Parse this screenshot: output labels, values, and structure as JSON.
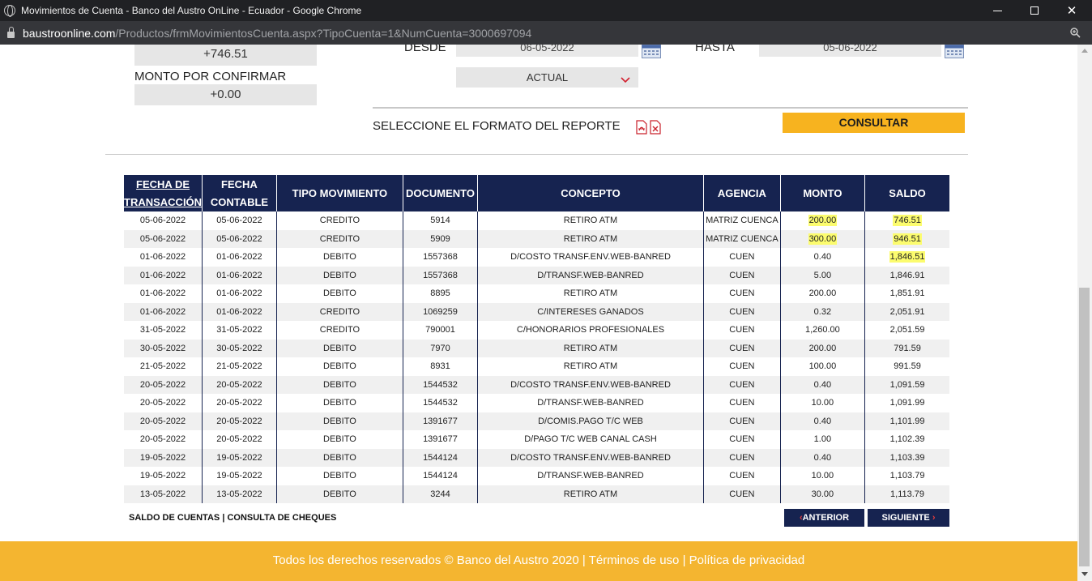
{
  "browser": {
    "window_title": "Movimientos de Cuenta - Banco del Austro OnLine - Ecuador - Google Chrome",
    "url_host": "baustroonline.com",
    "url_path": "/Productos/frmMovimientosCuenta.aspx?TipoCuenta=1&NumCuenta=3000697094"
  },
  "summary": {
    "saldo_value": "+746.51",
    "monto_por_confirmar_label": "MONTO POR CONFIRMAR",
    "monto_por_confirmar_value": "+0.00"
  },
  "filters": {
    "desde_label": "DESDE",
    "desde_value": "06-05-2022",
    "hasta_label": "HASTA",
    "hasta_value": "05-06-2022",
    "period_selected": "ACTUAL",
    "report_format_label": "SELECCIONE EL FORMATO DEL REPORTE",
    "consultar_label": "CONSULTAR"
  },
  "table": {
    "headers": {
      "fecha_transaccion": [
        "FECHA DE",
        "TRANSACCIÓN"
      ],
      "fecha_contable": [
        "FECHA",
        "CONTABLE"
      ],
      "tipo": "TIPO MOVIMIENTO",
      "documento": "DOCUMENTO",
      "concepto": "CONCEPTO",
      "agencia": "AGENCIA",
      "monto": "MONTO",
      "saldo": "SALDO"
    },
    "rows": [
      {
        "ft": "05-06-2022",
        "fc": "05-06-2022",
        "tipo": "CREDITO",
        "doc": "5914",
        "concepto": "RETIRO ATM",
        "agencia": "MATRIZ CUENCA",
        "monto": "200.00",
        "saldo": "746.51",
        "hl_monto": true,
        "hl_saldo": true
      },
      {
        "ft": "05-06-2022",
        "fc": "05-06-2022",
        "tipo": "CREDITO",
        "doc": "5909",
        "concepto": "RETIRO ATM",
        "agencia": "MATRIZ CUENCA",
        "monto": "300.00",
        "saldo": "946.51",
        "hl_monto": true,
        "hl_saldo": true
      },
      {
        "ft": "01-06-2022",
        "fc": "01-06-2022",
        "tipo": "DEBITO",
        "doc": "1557368",
        "concepto": "D/COSTO TRANSF.ENV.WEB-BANRED",
        "agencia": "CUEN",
        "monto": "0.40",
        "saldo": "1,846.51",
        "hl_monto": false,
        "hl_saldo": true
      },
      {
        "ft": "01-06-2022",
        "fc": "01-06-2022",
        "tipo": "DEBITO",
        "doc": "1557368",
        "concepto": "D/TRANSF.WEB-BANRED",
        "agencia": "CUEN",
        "monto": "5.00",
        "saldo": "1,846.91",
        "hl_monto": false,
        "hl_saldo": false
      },
      {
        "ft": "01-06-2022",
        "fc": "01-06-2022",
        "tipo": "DEBITO",
        "doc": "8895",
        "concepto": "RETIRO ATM",
        "agencia": "CUEN",
        "monto": "200.00",
        "saldo": "1,851.91",
        "hl_monto": false,
        "hl_saldo": false
      },
      {
        "ft": "01-06-2022",
        "fc": "01-06-2022",
        "tipo": "CREDITO",
        "doc": "1069259",
        "concepto": "C/INTERESES GANADOS",
        "agencia": "CUEN",
        "monto": "0.32",
        "saldo": "2,051.91",
        "hl_monto": false,
        "hl_saldo": false
      },
      {
        "ft": "31-05-2022",
        "fc": "31-05-2022",
        "tipo": "CREDITO",
        "doc": "790001",
        "concepto": "C/HONORARIOS PROFESIONALES",
        "agencia": "CUEN",
        "monto": "1,260.00",
        "saldo": "2,051.59",
        "hl_monto": false,
        "hl_saldo": false
      },
      {
        "ft": "30-05-2022",
        "fc": "30-05-2022",
        "tipo": "DEBITO",
        "doc": "7970",
        "concepto": "RETIRO ATM",
        "agencia": "CUEN",
        "monto": "200.00",
        "saldo": "791.59",
        "hl_monto": false,
        "hl_saldo": false
      },
      {
        "ft": "21-05-2022",
        "fc": "21-05-2022",
        "tipo": "DEBITO",
        "doc": "8931",
        "concepto": "RETIRO ATM",
        "agencia": "CUEN",
        "monto": "100.00",
        "saldo": "991.59",
        "hl_monto": false,
        "hl_saldo": false
      },
      {
        "ft": "20-05-2022",
        "fc": "20-05-2022",
        "tipo": "DEBITO",
        "doc": "1544532",
        "concepto": "D/COSTO TRANSF.ENV.WEB-BANRED",
        "agencia": "CUEN",
        "monto": "0.40",
        "saldo": "1,091.59",
        "hl_monto": false,
        "hl_saldo": false
      },
      {
        "ft": "20-05-2022",
        "fc": "20-05-2022",
        "tipo": "DEBITO",
        "doc": "1544532",
        "concepto": "D/TRANSF.WEB-BANRED",
        "agencia": "CUEN",
        "monto": "10.00",
        "saldo": "1,091.99",
        "hl_monto": false,
        "hl_saldo": false
      },
      {
        "ft": "20-05-2022",
        "fc": "20-05-2022",
        "tipo": "DEBITO",
        "doc": "1391677",
        "concepto": "D/COMIS.PAGO T/C WEB",
        "agencia": "CUEN",
        "monto": "0.40",
        "saldo": "1,101.99",
        "hl_monto": false,
        "hl_saldo": false
      },
      {
        "ft": "20-05-2022",
        "fc": "20-05-2022",
        "tipo": "DEBITO",
        "doc": "1391677",
        "concepto": "D/PAGO T/C WEB CANAL CASH",
        "agencia": "CUEN",
        "monto": "1.00",
        "saldo": "1,102.39",
        "hl_monto": false,
        "hl_saldo": false
      },
      {
        "ft": "19-05-2022",
        "fc": "19-05-2022",
        "tipo": "DEBITO",
        "doc": "1544124",
        "concepto": "D/COSTO TRANSF.ENV.WEB-BANRED",
        "agencia": "CUEN",
        "monto": "0.40",
        "saldo": "1,103.39",
        "hl_monto": false,
        "hl_saldo": false
      },
      {
        "ft": "19-05-2022",
        "fc": "19-05-2022",
        "tipo": "DEBITO",
        "doc": "1544124",
        "concepto": "D/TRANSF.WEB-BANRED",
        "agencia": "CUEN",
        "monto": "10.00",
        "saldo": "1,103.79",
        "hl_monto": false,
        "hl_saldo": false
      },
      {
        "ft": "13-05-2022",
        "fc": "13-05-2022",
        "tipo": "DEBITO",
        "doc": "3244",
        "concepto": "RETIRO ATM",
        "agencia": "CUEN",
        "monto": "30.00",
        "saldo": "1,113.79",
        "hl_monto": false,
        "hl_saldo": false
      }
    ]
  },
  "links": {
    "saldo_cuentas": "SALDO DE CUENTAS",
    "separator": "|",
    "consulta_cheques": "CONSULTA DE CHEQUES"
  },
  "pager": {
    "prev_arrow": "‹",
    "prev": "ANTERIOR",
    "next": "SIGUIENTE",
    "next_arrow": "›"
  },
  "footer": {
    "copyright": "Todos los derechos reservados © Banco del Austro 2020",
    "sep1": "|",
    "terms": "Términos de uso",
    "sep2": "|",
    "privacy": "Política de privacidad"
  },
  "colors": {
    "navy": "#162350",
    "accent_yellow": "#f7b31f",
    "highlight": "#fcfc6e"
  }
}
